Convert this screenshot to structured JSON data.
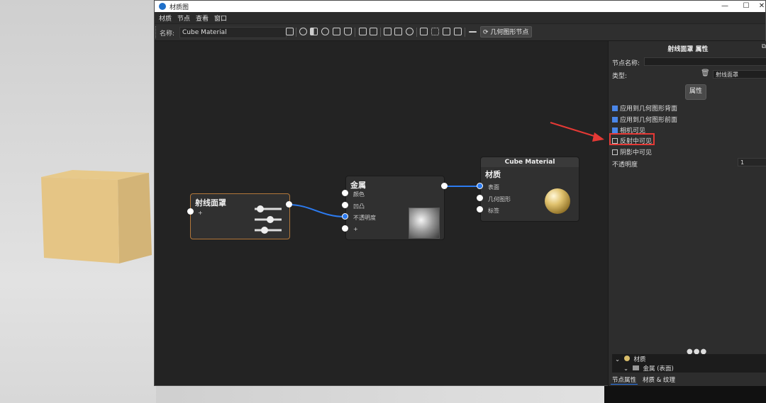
{
  "window": {
    "title": "材质图",
    "controls": {
      "min": "—",
      "max": "☐",
      "close": "✕"
    }
  },
  "menu": [
    "材质",
    "节点",
    "查看",
    "窗口"
  ],
  "toolbar": {
    "name_label": "名称:",
    "name_value": "Cube Material",
    "geometry_nodes_button": "几何图形节点"
  },
  "nodes": {
    "ray_mask": {
      "title": "射线面罩",
      "plus": "+"
    },
    "metal": {
      "title": "金属",
      "ports": [
        "颜色",
        "凹凸",
        "不透明度",
        "+"
      ]
    },
    "cube_material": {
      "header": "Cube Material",
      "title": "材质",
      "ports": [
        "表面",
        "几何图形",
        "标签"
      ]
    }
  },
  "panel": {
    "title": "射线面罩 属性",
    "node_name_label": "节点名称:",
    "node_name_value": "",
    "type_label": "类型:",
    "type_value": "射线面罩",
    "attributes_button": "属性",
    "checkboxes": [
      {
        "label": "应用到几何图形背面",
        "checked": true
      },
      {
        "label": "应用到几何图形前面",
        "checked": true
      },
      {
        "label": "相机可见",
        "checked": true
      },
      {
        "label": "反射中可见",
        "checked": false
      },
      {
        "label": "阴影中可见",
        "checked": false
      }
    ],
    "opacity_label": "不透明度",
    "opacity_value": "1",
    "tree": {
      "root": "材质",
      "child": "金属 (表面)"
    },
    "tabs": [
      "节点属性",
      "材质 & 纹理"
    ]
  },
  "colors": {
    "accent": "#2c7bf0",
    "selected_node_border": "#b3773a",
    "annotation": "#e53935"
  },
  "icons": [
    "save-icon",
    "sphere-icon",
    "checker-icon",
    "target-icon",
    "sliders-icon",
    "trash-icon",
    "copy-icon",
    "grid-icon",
    "fit-icon",
    "refresh-icon"
  ]
}
